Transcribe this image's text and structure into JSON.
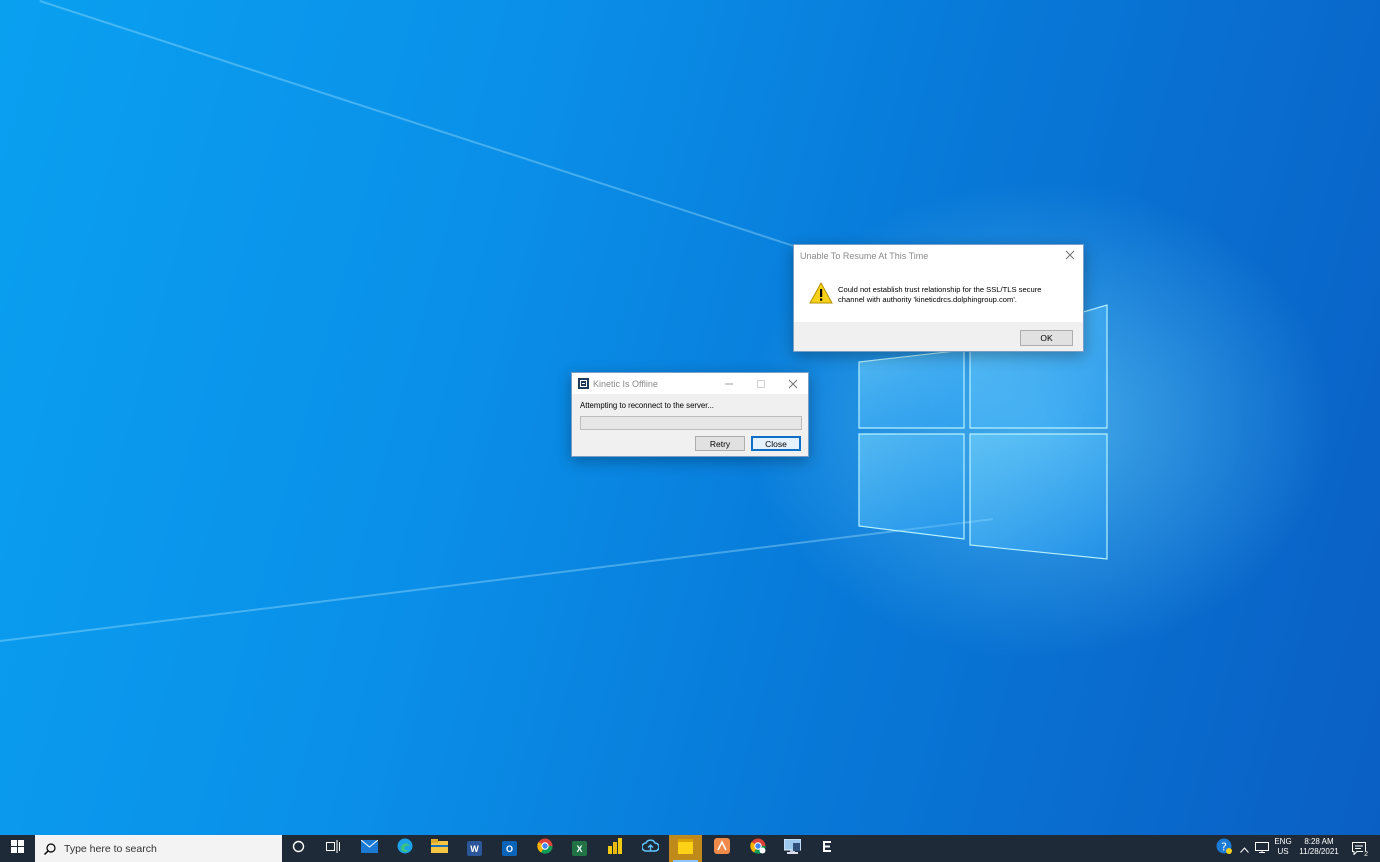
{
  "colors": {
    "wallpaper_light": "#0aa0f0",
    "wallpaper_dark": "#0a5fc4",
    "taskbar": "#1e2a37",
    "dialog_bg": "#f0f0f0",
    "accent": "#0f6fc6",
    "warning": "#f7d117"
  },
  "error_dialog": {
    "title": "Unable To Resume At This Time",
    "message_line1": "Could not establish trust relationship for the SSL/TLS secure",
    "message_line2": "channel with authority 'kineticdrcs.dolphingroup.com'.",
    "ok_label": "OK",
    "icon": "warning-icon"
  },
  "offline_dialog": {
    "title": "Kinetic Is Offline",
    "message": "Attempting to reconnect to the server...",
    "progress": 0,
    "retry_label": "Retry",
    "close_label": "Close",
    "app_icon": "kinetic-app-icon"
  },
  "taskbar": {
    "search_placeholder": "Type here to search",
    "pinned_apps": [
      {
        "name": "mail",
        "running": false
      },
      {
        "name": "edge",
        "running": false
      },
      {
        "name": "file-explorer",
        "running": false
      },
      {
        "name": "word",
        "running": false
      },
      {
        "name": "outlook",
        "running": false
      },
      {
        "name": "chrome",
        "running": false
      },
      {
        "name": "excel",
        "running": false
      },
      {
        "name": "power-bi",
        "running": false
      },
      {
        "name": "cloud-sync",
        "running": false
      },
      {
        "name": "sticky-notes",
        "running": true
      },
      {
        "name": "slides-app",
        "running": false
      },
      {
        "name": "chrome-alt",
        "running": false
      },
      {
        "name": "remote-desktop",
        "running": false
      },
      {
        "name": "kinetic",
        "running": false
      }
    ],
    "tray": {
      "language_line1": "ENG",
      "language_line2": "US",
      "time": "8:28 AM",
      "date": "11/28/2021",
      "notification_count": "2"
    }
  }
}
